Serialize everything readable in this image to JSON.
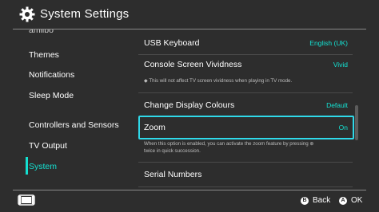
{
  "header": {
    "title": "System Settings"
  },
  "sidebar": {
    "items": [
      {
        "label": "amiibo"
      },
      {
        "label": "Themes"
      },
      {
        "label": "Notifications"
      },
      {
        "label": "Sleep Mode"
      },
      {
        "label": "Controllers and Sensors"
      },
      {
        "label": "TV Output"
      },
      {
        "label": "System"
      }
    ]
  },
  "settings": {
    "usb_keyboard": {
      "label": "USB Keyboard",
      "value": "English (UK)"
    },
    "vividness": {
      "label": "Console Screen Vividness",
      "value": "Vivid",
      "note": "◆ This will not affect TV screen vividness when playing in TV mode."
    },
    "display_colours": {
      "label": "Change Display Colours",
      "value": "Default"
    },
    "zoom": {
      "label": "Zoom",
      "value": "On",
      "note_line1": "When this option is enabled, you can activate the zoom feature by pressing ⊕",
      "note_line2": "twice in quick succession."
    },
    "serial_numbers": {
      "label": "Serial Numbers"
    }
  },
  "footer": {
    "back": {
      "key": "B",
      "label": "Back"
    },
    "ok": {
      "key": "A",
      "label": "OK"
    }
  },
  "colors": {
    "accent": "#14e0d1",
    "focus": "#2fd9e9",
    "background": "#2d2d2d"
  }
}
